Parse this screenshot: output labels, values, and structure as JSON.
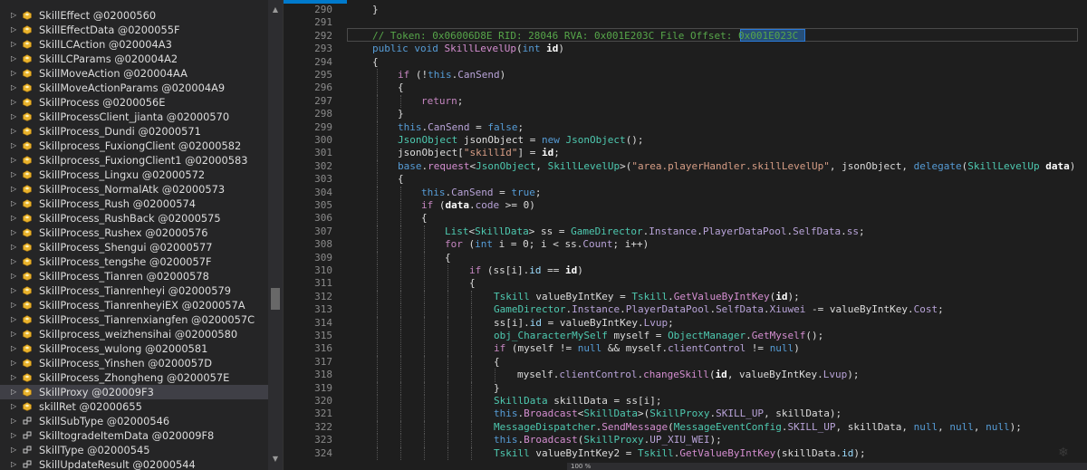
{
  "tree": {
    "items": [
      {
        "label": "SkillEffect @02000560",
        "type": "class",
        "expanded": false
      },
      {
        "label": "SkillEffectData @0200055F",
        "type": "class",
        "expanded": false
      },
      {
        "label": "SkillLCAction @020004A3",
        "type": "class",
        "expanded": false
      },
      {
        "label": "SkillLCParams @020004A2",
        "type": "class",
        "expanded": false
      },
      {
        "label": "SkillMoveAction @020004AA",
        "type": "class",
        "expanded": false
      },
      {
        "label": "SkillMoveActionParams @020004A9",
        "type": "class",
        "expanded": false
      },
      {
        "label": "SkillProcess @0200056E",
        "type": "class",
        "expanded": false
      },
      {
        "label": "SkillProcessClient_jianta @02000570",
        "type": "class",
        "expanded": false
      },
      {
        "label": "SkillProcess_Dundi @02000571",
        "type": "class",
        "expanded": false
      },
      {
        "label": "Skillprocess_FuxiongClient @02000582",
        "type": "class",
        "expanded": false
      },
      {
        "label": "Skillprocess_FuxiongClient1 @02000583",
        "type": "class",
        "expanded": false
      },
      {
        "label": "SkillProcess_Lingxu @02000572",
        "type": "class",
        "expanded": false
      },
      {
        "label": "SkillProcess_NormalAtk @02000573",
        "type": "class",
        "expanded": false
      },
      {
        "label": "SkillProcess_Rush @02000574",
        "type": "class",
        "expanded": false
      },
      {
        "label": "SkillProcess_RushBack @02000575",
        "type": "class",
        "expanded": false
      },
      {
        "label": "SkillProcess_Rushex @02000576",
        "type": "class",
        "expanded": false
      },
      {
        "label": "SkillProcess_Shengui @02000577",
        "type": "class",
        "expanded": false
      },
      {
        "label": "SkillProcess_tengshe @0200057F",
        "type": "class",
        "expanded": false
      },
      {
        "label": "SkillProcess_Tianren @02000578",
        "type": "class",
        "expanded": false
      },
      {
        "label": "SkillProcess_Tianrenheyi @02000579",
        "type": "class",
        "expanded": false
      },
      {
        "label": "SkillProcess_TianrenheyiEX @0200057A",
        "type": "class",
        "expanded": false
      },
      {
        "label": "SkillProcess_Tianrenxiangfen @0200057C",
        "type": "class",
        "expanded": false
      },
      {
        "label": "Skillprocess_weizhensihai @02000580",
        "type": "class",
        "expanded": false
      },
      {
        "label": "SkillProcess_wulong @02000581",
        "type": "class",
        "expanded": false
      },
      {
        "label": "SkillProcess_Yinshen @0200057D",
        "type": "class",
        "expanded": false
      },
      {
        "label": "SkillProcess_Zhongheng @0200057E",
        "type": "class",
        "expanded": false
      },
      {
        "label": "SkillProxy @020009F3",
        "type": "class",
        "expanded": false,
        "selected": true
      },
      {
        "label": "skillRet @02000655",
        "type": "class",
        "expanded": false
      },
      {
        "label": "SkillSubType @02000546",
        "type": "struct",
        "expanded": false
      },
      {
        "label": "SkilltogradeItemData @020009F8",
        "type": "struct",
        "expanded": false
      },
      {
        "label": "SkillType @02000545",
        "type": "struct",
        "expanded": false
      },
      {
        "label": "SkillUpdateResult @02000544",
        "type": "struct",
        "expanded": false
      }
    ]
  },
  "editor": {
    "zoom": "100 %",
    "lines": [
      {
        "n": "290",
        "indent": 1,
        "tokens": [
          [
            "}",
            ""
          ]
        ]
      },
      {
        "n": "291",
        "indent": 0,
        "tokens": []
      },
      {
        "n": "292",
        "indent": 1,
        "tokens": [
          [
            "// Token: 0x06006D8E RID: 28046 RVA: 0x001E203C File Offset: ",
            "cm"
          ],
          [
            "0x001E023C",
            "cm"
          ]
        ]
      },
      {
        "n": "293",
        "indent": 1,
        "tokens": [
          [
            "public void ",
            "kw"
          ],
          [
            "SkillLevelUp",
            "mth"
          ],
          [
            "(",
            ""
          ],
          [
            "int ",
            "kw"
          ],
          [
            "id",
            "bold"
          ],
          [
            ")",
            ""
          ]
        ]
      },
      {
        "n": "294",
        "indent": 1,
        "tokens": [
          [
            "{",
            ""
          ]
        ]
      },
      {
        "n": "295",
        "indent": 2,
        "tokens": [
          [
            "if ",
            "kw2"
          ],
          [
            "(!",
            ""
          ],
          [
            "this",
            "kw"
          ],
          [
            ".",
            ""
          ],
          [
            "CanSend",
            "mem"
          ],
          [
            ")",
            ""
          ]
        ]
      },
      {
        "n": "296",
        "indent": 2,
        "tokens": [
          [
            "{",
            ""
          ]
        ]
      },
      {
        "n": "297",
        "indent": 3,
        "tokens": [
          [
            "return",
            "kw2"
          ],
          [
            ";",
            ""
          ]
        ]
      },
      {
        "n": "298",
        "indent": 2,
        "tokens": [
          [
            "}",
            ""
          ]
        ]
      },
      {
        "n": "299",
        "indent": 2,
        "tokens": [
          [
            "this",
            "kw"
          ],
          [
            ".",
            ""
          ],
          [
            "CanSend",
            "mem"
          ],
          [
            " = ",
            ""
          ],
          [
            "false",
            "kw"
          ],
          [
            ";",
            ""
          ]
        ]
      },
      {
        "n": "300",
        "indent": 2,
        "tokens": [
          [
            "JsonObject ",
            "ty"
          ],
          [
            "jsonObject = ",
            ""
          ],
          [
            "new ",
            "kw"
          ],
          [
            "JsonObject",
            "ty"
          ],
          [
            "();",
            ""
          ]
        ]
      },
      {
        "n": "301",
        "indent": 2,
        "tokens": [
          [
            "jsonObject[",
            ""
          ],
          [
            "\"skillId\"",
            "str"
          ],
          [
            "] = ",
            ""
          ],
          [
            "id",
            "bold"
          ],
          [
            ";",
            ""
          ]
        ]
      },
      {
        "n": "302",
        "indent": 2,
        "tokens": [
          [
            "base",
            "kw"
          ],
          [
            ".",
            ""
          ],
          [
            "request",
            "mth"
          ],
          [
            "<",
            ""
          ],
          [
            "JsonObject",
            "ty"
          ],
          [
            ", ",
            ""
          ],
          [
            "SkillLevelUp",
            "ty"
          ],
          [
            ">(",
            ""
          ],
          [
            "\"area.playerHandler.skillLevelUp\"",
            "str"
          ],
          [
            ", jsonObject, ",
            ""
          ],
          [
            "delegate",
            "kw"
          ],
          [
            "(",
            ""
          ],
          [
            "SkillLevelUp ",
            "ty"
          ],
          [
            "data",
            "bold"
          ],
          [
            ")",
            ""
          ]
        ]
      },
      {
        "n": "303",
        "indent": 2,
        "tokens": [
          [
            "{",
            ""
          ]
        ]
      },
      {
        "n": "304",
        "indent": 3,
        "tokens": [
          [
            "this",
            "kw"
          ],
          [
            ".",
            ""
          ],
          [
            "CanSend",
            "mem"
          ],
          [
            " = ",
            ""
          ],
          [
            "true",
            "kw"
          ],
          [
            ";",
            ""
          ]
        ]
      },
      {
        "n": "305",
        "indent": 3,
        "tokens": [
          [
            "if ",
            "kw2"
          ],
          [
            "(",
            ""
          ],
          [
            "data",
            "bold"
          ],
          [
            ".",
            ""
          ],
          [
            "code",
            "mem"
          ],
          [
            " >= 0)",
            ""
          ]
        ]
      },
      {
        "n": "306",
        "indent": 3,
        "tokens": [
          [
            "{",
            ""
          ]
        ]
      },
      {
        "n": "307",
        "indent": 4,
        "tokens": [
          [
            "List",
            "ty"
          ],
          [
            "<",
            ""
          ],
          [
            "SkillData",
            "ty"
          ],
          [
            "> ss = ",
            ""
          ],
          [
            "GameDirector",
            "ty"
          ],
          [
            ".",
            ""
          ],
          [
            "Instance",
            "mem"
          ],
          [
            ".",
            ""
          ],
          [
            "PlayerDataPool",
            "mem"
          ],
          [
            ".",
            ""
          ],
          [
            "SelfData",
            "mem"
          ],
          [
            ".",
            ""
          ],
          [
            "ss",
            "mem"
          ],
          [
            ";",
            ""
          ]
        ]
      },
      {
        "n": "308",
        "indent": 4,
        "tokens": [
          [
            "for ",
            "kw2"
          ],
          [
            "(",
            ""
          ],
          [
            "int ",
            "kw"
          ],
          [
            "i = 0; i < ss.",
            ""
          ],
          [
            "Count",
            "mem"
          ],
          [
            "; i++)",
            ""
          ]
        ]
      },
      {
        "n": "309",
        "indent": 4,
        "tokens": [
          [
            "{",
            ""
          ]
        ]
      },
      {
        "n": "310",
        "indent": 5,
        "tokens": [
          [
            "if ",
            "kw2"
          ],
          [
            "(ss[i].",
            ""
          ],
          [
            "id",
            "fld"
          ],
          [
            " == ",
            ""
          ],
          [
            "id",
            "bold"
          ],
          [
            ")",
            ""
          ]
        ]
      },
      {
        "n": "311",
        "indent": 5,
        "tokens": [
          [
            "{",
            ""
          ]
        ]
      },
      {
        "n": "312",
        "indent": 6,
        "tokens": [
          [
            "Tskill ",
            "ty"
          ],
          [
            "valueByIntKey = ",
            ""
          ],
          [
            "Tskill",
            "ty"
          ],
          [
            ".",
            ""
          ],
          [
            "GetValueByIntKey",
            "mth"
          ],
          [
            "(",
            ""
          ],
          [
            "id",
            "bold"
          ],
          [
            ");",
            ""
          ]
        ]
      },
      {
        "n": "313",
        "indent": 6,
        "tokens": [
          [
            "GameDirector",
            "ty"
          ],
          [
            ".",
            ""
          ],
          [
            "Instance",
            "mem"
          ],
          [
            ".",
            ""
          ],
          [
            "PlayerDataPool",
            "mem"
          ],
          [
            ".",
            ""
          ],
          [
            "SelfData",
            "mem"
          ],
          [
            ".",
            ""
          ],
          [
            "Xiuwei",
            "mem"
          ],
          [
            " -= valueByIntKey.",
            ""
          ],
          [
            "Cost",
            "mem"
          ],
          [
            ";",
            ""
          ]
        ]
      },
      {
        "n": "314",
        "indent": 6,
        "tokens": [
          [
            "ss[i].",
            ""
          ],
          [
            "id",
            "fld"
          ],
          [
            " = valueByIntKey.",
            ""
          ],
          [
            "Lvup",
            "mem"
          ],
          [
            ";",
            ""
          ]
        ]
      },
      {
        "n": "315",
        "indent": 6,
        "tokens": [
          [
            "obj_CharacterMySelf ",
            "ty"
          ],
          [
            "myself = ",
            ""
          ],
          [
            "ObjectManager",
            "ty"
          ],
          [
            ".",
            ""
          ],
          [
            "GetMyself",
            "mth"
          ],
          [
            "();",
            ""
          ]
        ]
      },
      {
        "n": "316",
        "indent": 6,
        "tokens": [
          [
            "if ",
            "kw2"
          ],
          [
            "(myself != ",
            ""
          ],
          [
            "null ",
            "kw"
          ],
          [
            "&& myself.",
            ""
          ],
          [
            "clientControl",
            "mem"
          ],
          [
            " != ",
            ""
          ],
          [
            "null",
            "kw"
          ],
          [
            ")",
            ""
          ]
        ]
      },
      {
        "n": "317",
        "indent": 6,
        "tokens": [
          [
            "{",
            ""
          ]
        ]
      },
      {
        "n": "318",
        "indent": 7,
        "tokens": [
          [
            "myself.",
            ""
          ],
          [
            "clientControl",
            "mem"
          ],
          [
            ".",
            ""
          ],
          [
            "changeSkill",
            "mth"
          ],
          [
            "(",
            ""
          ],
          [
            "id",
            "bold"
          ],
          [
            ", valueByIntKey.",
            ""
          ],
          [
            "Lvup",
            "mem"
          ],
          [
            ");",
            ""
          ]
        ]
      },
      {
        "n": "319",
        "indent": 6,
        "tokens": [
          [
            "}",
            ""
          ]
        ]
      },
      {
        "n": "320",
        "indent": 6,
        "tokens": [
          [
            "SkillData ",
            "ty"
          ],
          [
            "skillData = ss[i];",
            ""
          ]
        ]
      },
      {
        "n": "321",
        "indent": 6,
        "tokens": [
          [
            "this",
            "kw"
          ],
          [
            ".",
            ""
          ],
          [
            "Broadcast",
            "mth"
          ],
          [
            "<",
            ""
          ],
          [
            "SkillData",
            "ty"
          ],
          [
            ">(",
            ""
          ],
          [
            "SkillProxy",
            "ty"
          ],
          [
            ".",
            ""
          ],
          [
            "SKILL_UP",
            "mem"
          ],
          [
            ", skillData);",
            ""
          ]
        ]
      },
      {
        "n": "322",
        "indent": 6,
        "tokens": [
          [
            "MessageDispatcher",
            "ty"
          ],
          [
            ".",
            ""
          ],
          [
            "SendMessage",
            "mth"
          ],
          [
            "(",
            ""
          ],
          [
            "MessageEventConfig",
            "ty"
          ],
          [
            ".",
            ""
          ],
          [
            "SKILL_UP",
            "mem"
          ],
          [
            ", skillData, ",
            ""
          ],
          [
            "null",
            "kw"
          ],
          [
            ", ",
            ""
          ],
          [
            "null",
            "kw"
          ],
          [
            ", ",
            ""
          ],
          [
            "null",
            "kw"
          ],
          [
            ");",
            ""
          ]
        ]
      },
      {
        "n": "323",
        "indent": 6,
        "tokens": [
          [
            "this",
            "kw"
          ],
          [
            ".",
            ""
          ],
          [
            "Broadcast",
            "mth"
          ],
          [
            "(",
            ""
          ],
          [
            "SkillProxy",
            "ty"
          ],
          [
            ".",
            ""
          ],
          [
            "UP_XIU_WEI",
            "mem"
          ],
          [
            ");",
            ""
          ]
        ]
      },
      {
        "n": "324",
        "indent": 6,
        "tokens": [
          [
            "Tskill ",
            "ty"
          ],
          [
            "valueByIntKey2 = ",
            ""
          ],
          [
            "Tskill",
            "ty"
          ],
          [
            ".",
            ""
          ],
          [
            "GetValueByIntKey",
            "mth"
          ],
          [
            "(skillData.",
            ""
          ],
          [
            "id",
            "fld"
          ],
          [
            ");",
            ""
          ]
        ]
      }
    ]
  }
}
